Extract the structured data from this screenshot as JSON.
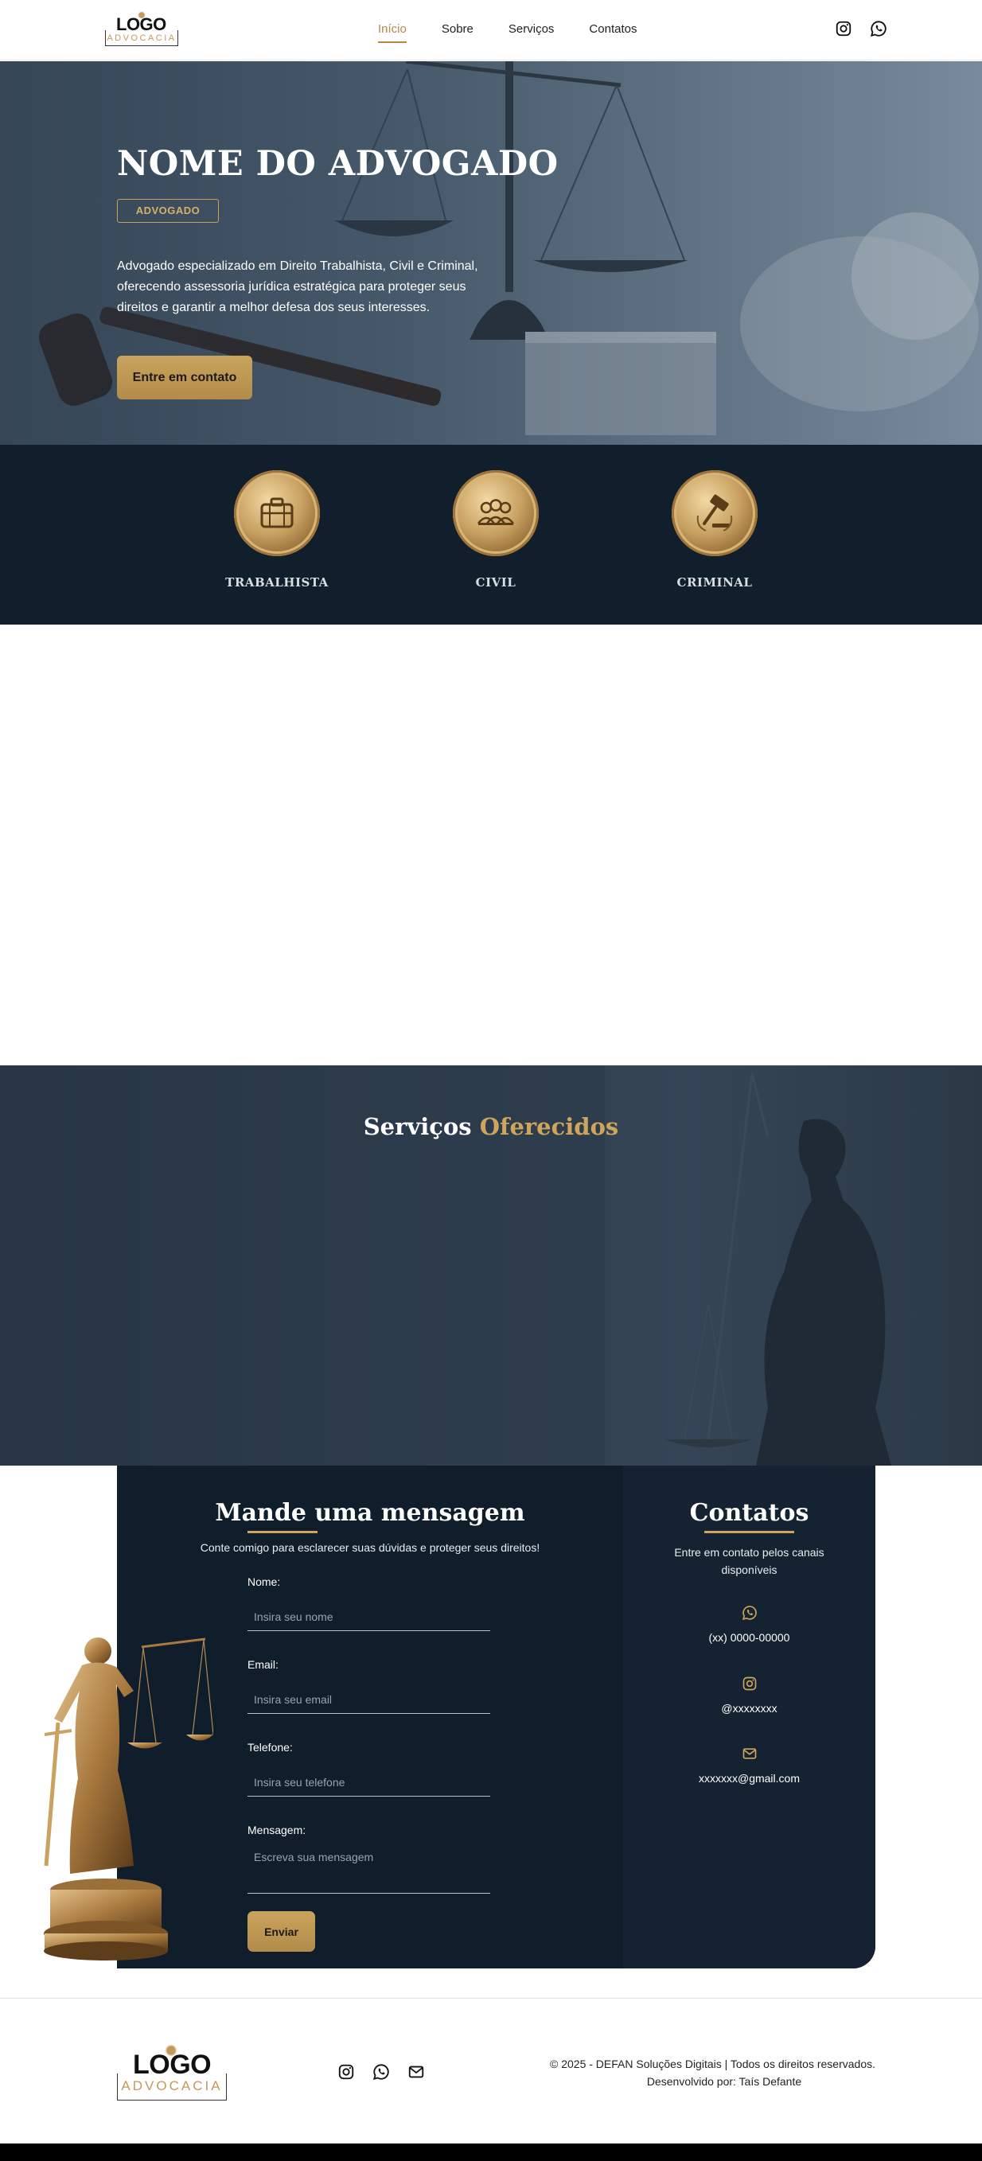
{
  "header": {
    "logo": {
      "word": "LOGO",
      "sub": "ADVOCACIA"
    },
    "nav": [
      {
        "label": "Início",
        "active": true
      },
      {
        "label": "Sobre",
        "active": false
      },
      {
        "label": "Serviços",
        "active": false
      },
      {
        "label": "Contatos",
        "active": false
      }
    ],
    "icons": [
      "instagram-icon",
      "whatsapp-icon"
    ]
  },
  "hero": {
    "title": "NOME DO ADVOGADO",
    "badge": "ADVOGADO",
    "description": "Advogado especializado em Direito Trabalhista, Civil e Criminal, oferecendo assessoria jurídica estratégica para proteger seus direitos e garantir a melhor defesa dos seus interesses.",
    "cta": "Entre em contato"
  },
  "areas": [
    {
      "label": "TRABALHISTA",
      "icon": "briefcase-icon"
    },
    {
      "label": "CIVIL",
      "icon": "people-icon"
    },
    {
      "label": "CRIMINAL",
      "icon": "gavel-icon"
    }
  ],
  "services": {
    "title_main": "Serviços",
    "title_accent": "Oferecidos"
  },
  "contact_form": {
    "title": "Mande uma mensagem",
    "subtitle": "Conte comigo para esclarecer suas dúvidas e proteger seus direitos!",
    "fields": {
      "name": {
        "label": "Nome:",
        "placeholder": "Insira seu nome"
      },
      "email": {
        "label": "Email:",
        "placeholder": "Insira seu email"
      },
      "phone": {
        "label": "Telefone:",
        "placeholder": "Insira seu telefone"
      },
      "message": {
        "label": "Mensagem:",
        "placeholder": "Escreva sua mensagem"
      }
    },
    "submit": "Enviar"
  },
  "contacts": {
    "title": "Contatos",
    "subtitle": "Entre em contato pelos canais disponíveis",
    "items": [
      {
        "icon": "whatsapp-icon",
        "value": "(xx) 0000-00000"
      },
      {
        "icon": "instagram-icon",
        "value": "@xxxxxxxx"
      },
      {
        "icon": "mail-icon",
        "value": "xxxxxxx@gmail.com"
      }
    ]
  },
  "footer": {
    "logo": {
      "word": "LOGO",
      "sub": "ADVOCACIA"
    },
    "icons": [
      "instagram-icon",
      "whatsapp-icon",
      "mail-icon"
    ],
    "copyright": "© 2025 - DEFAN Soluções Digitais | Todos os direitos reservados.",
    "credit": "Desenvolvido por: Taís Defante"
  },
  "colors": {
    "accent_gold": "#c9a45d",
    "navy": "#101d2a",
    "nav_active": "#b4884a"
  }
}
